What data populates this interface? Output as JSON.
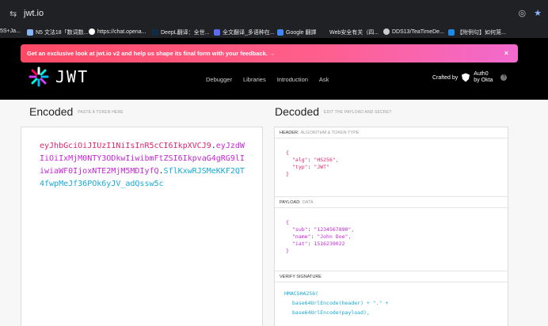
{
  "browser": {
    "url": "jwt.io",
    "bookmarks": [
      {
        "label": "5S+Ja...",
        "color": "#777"
      },
      {
        "label": "N5 文法18「数词数...",
        "color": "#8ab4f8"
      },
      {
        "label": "https://chat.opena...",
        "color": "#ffffff"
      },
      {
        "label": "DeepL翻译：全世...",
        "color": "#0f2b46"
      },
      {
        "label": "全文翻译_多语种在...",
        "color": "#5a6cf0"
      },
      {
        "label": "Google 翻譯",
        "color": "#4285f4"
      },
      {
        "label": "Web安全有关（四...",
        "color": "#999"
      },
      {
        "label": "DDS13/TeaTimeDe...",
        "color": "#ccc"
      },
      {
        "label": "【附例句】如何笼...",
        "color": "#1e88e5"
      }
    ]
  },
  "promo": {
    "text": "Get an exclusive look at jwt.io v2 and help us shape its final form with your feedback. →",
    "close": "×"
  },
  "header": {
    "logo": "JWT",
    "nav": [
      "Debugger",
      "Libraries",
      "Introduction",
      "Ask"
    ],
    "crafted_by": "Crafted by",
    "auth0_line1": "Auth0",
    "auth0_line2": "by Okta",
    "help": "?"
  },
  "encoded": {
    "title": "Encoded",
    "subtitle": "PASTE A TOKEN HERE",
    "token_header": "eyJhbGciOiJIUzI1NiIsInR5cCI6IkpXVCJ9",
    "token_payload": "eyJzdWIiOiIxMjM0NTY3ODkwIiwibmFtZSI6IkpvaG4gRG9lIiwiaWF0IjoxNTE2MjM5MDIyfQ",
    "token_signature": "SflKxwRJSMeKKF2QT4fwpMeJf36POk6yJV_adQssw5c"
  },
  "decoded": {
    "title": "Decoded",
    "subtitle": "EDIT THE PAYLOAD AND SECRET",
    "header_label": "HEADER:",
    "header_sub": "ALGORITHM & TOKEN TYPE",
    "header_json": {
      "alg_key": "\"alg\"",
      "alg_val": "\"HS256\",",
      "typ_key": "\"typ\"",
      "typ_val": "\"JWT\""
    },
    "payload_label": "PAYLOAD:",
    "payload_sub": "DATA",
    "payload_json": {
      "sub_key": "\"sub\"",
      "sub_val": "\"1234567890\",",
      "name_key": "\"name\"",
      "name_val": "\"John Doe\",",
      "iat_key": "\"iat\"",
      "iat_val": "1516239022"
    },
    "signature_label": "VERIFY SIGNATURE",
    "sig_line1": "HMACSHA256(",
    "sig_line2": "base64UrlEncode(header) + \".\" +",
    "sig_line3": "base64UrlEncode(payload),"
  }
}
